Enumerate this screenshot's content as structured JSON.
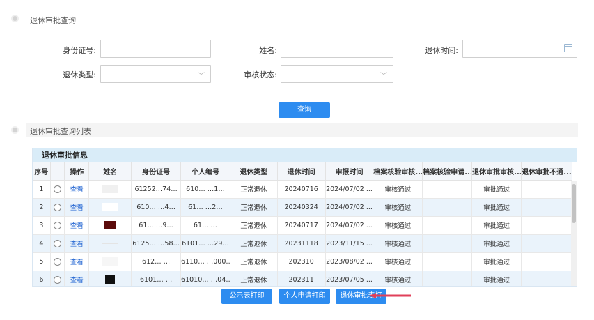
{
  "query_section": {
    "title": "退休审批查询",
    "fields": {
      "id_card": {
        "label": "身份证号:",
        "value": ""
      },
      "name": {
        "label": "姓名:",
        "value": ""
      },
      "retire_time": {
        "label": "退休时间:",
        "value": ""
      },
      "retire_type": {
        "label": "退休类型:",
        "value": ""
      },
      "review_status": {
        "label": "审核状态:",
        "value": ""
      }
    },
    "query_button": "查询"
  },
  "list_section": {
    "title": "退休审批查询列表",
    "table_title": "退休审批信息",
    "columns": [
      "序号",
      "操作",
      "姓名",
      "身份证号",
      "个人编号",
      "退休类型",
      "退休时间",
      "申报时间",
      "档案核验审核...",
      "档案核验申请...",
      "退休审批审核...",
      "退休审批不通..."
    ],
    "rows": [
      {
        "no": "1",
        "action": "查看",
        "id_card": "61252…74…",
        "person_no": "610… …1…",
        "type": "正常退休",
        "retire_time": "20240716",
        "report_time": "2024/07/02 ...",
        "archive_review": "审核通过",
        "archive_apply": "",
        "approve_review": "审批通过",
        "reject": ""
      },
      {
        "no": "2",
        "action": "查看",
        "id_card": "610… …4…",
        "person_no": "61… …2…",
        "type": "正常退休",
        "retire_time": "20240324",
        "report_time": "2024/07/02 ...",
        "archive_review": "审核通过",
        "archive_apply": "",
        "approve_review": "审批通过",
        "reject": ""
      },
      {
        "no": "3",
        "action": "查看",
        "id_card": "61… …9…",
        "person_no": "61… …",
        "type": "正常退休",
        "retire_time": "20240717",
        "report_time": "2024/07/02 ...",
        "archive_review": "审核通过",
        "archive_apply": "",
        "approve_review": "审批通过",
        "reject": ""
      },
      {
        "no": "4",
        "action": "查看",
        "id_card": "6125… …58…",
        "person_no": "6101… …29…",
        "type": "正常退休",
        "retire_time": "20231118",
        "report_time": "2023/11/15 ...",
        "archive_review": "审核通过",
        "archive_apply": "",
        "approve_review": "审批通过",
        "reject": ""
      },
      {
        "no": "5",
        "action": "查看",
        "id_card": "612… …",
        "person_no": "6110… …000…",
        "type": "正常退休",
        "retire_time": "202310",
        "report_time": "2023/08/02 ...",
        "archive_review": "审核通过",
        "archive_apply": "",
        "approve_review": "审批通过",
        "reject": ""
      },
      {
        "no": "6",
        "action": "查看",
        "id_card": "6101… …",
        "person_no": "61010… …04…",
        "type": "正常退休",
        "retire_time": "202311",
        "report_time": "2023/07/05 ...",
        "archive_review": "审核通过",
        "archive_apply": "",
        "approve_review": "审批通过",
        "reject": ""
      }
    ],
    "buttons": {
      "public_print": "公示表打印",
      "personal_print": "个人申请打印",
      "approval_print": "退休审批表打"
    }
  },
  "colors": {
    "primary": "#2d8cf0",
    "link": "#1a5fd0",
    "table_header_bg": "#d9ecf8",
    "row_alt_bg": "#eaf3fb",
    "annotation_arrow": "#e0405a"
  },
  "icons": [
    "calendar-icon",
    "chevron-down-icon",
    "radio-icon",
    "timeline-dot-icon",
    "red-arrow-annotation"
  ]
}
